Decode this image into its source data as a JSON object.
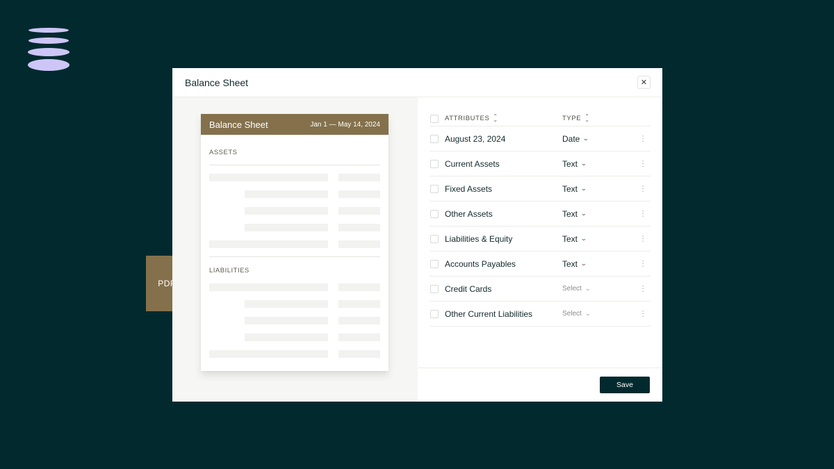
{
  "modal": {
    "title": "Balance Sheet",
    "close_symbol": "✕"
  },
  "document": {
    "title": "Balance Sheet",
    "date_range": "Jan 1 — May 14, 2024",
    "sections": [
      "ASSETS",
      "LIABILITIES"
    ]
  },
  "file_badge": {
    "label": "PDF"
  },
  "table": {
    "columns": {
      "attributes": "ATTRIBUTES",
      "type": "TYPE"
    },
    "rows": [
      {
        "attribute": "August 23, 2024",
        "type": "Date"
      },
      {
        "attribute": "Current Assets",
        "type": "Text"
      },
      {
        "attribute": "Fixed Assets",
        "type": "Text"
      },
      {
        "attribute": "Other Assets",
        "type": "Text"
      },
      {
        "attribute": "Liabilities & Equity",
        "type": "Text"
      },
      {
        "attribute": "Accounts Payables",
        "type": "Text"
      },
      {
        "attribute": "Credit Cards",
        "type": "Select"
      },
      {
        "attribute": "Other Current Liabilities",
        "type": "Select"
      }
    ]
  },
  "footer": {
    "save_label": "Save"
  },
  "colors": {
    "background": "#022a2e",
    "accent": "#84714c",
    "logo": "#cdc6f7"
  },
  "icons": {
    "logo": "stacked-discs-icon",
    "close": "close-icon",
    "sort": "sort-icon",
    "chevron": "chevron-down-icon",
    "row_menu": "kebab-menu-icon",
    "file": "pdf-file-icon"
  }
}
